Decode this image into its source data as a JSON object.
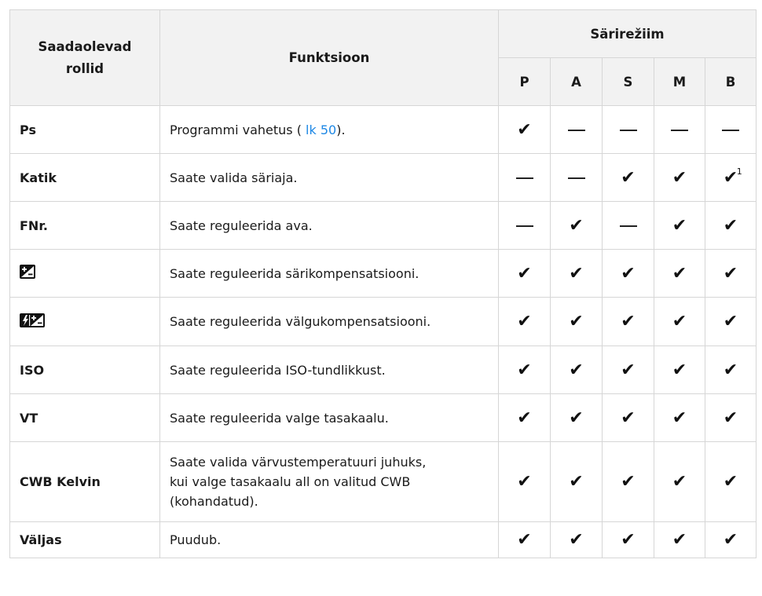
{
  "header": {
    "roles": "Saadaolevad rollid",
    "function": "Funktsioon",
    "mode_group": "Särirežiim",
    "modes": [
      "P",
      "A",
      "S",
      "M",
      "B"
    ]
  },
  "rows": [
    {
      "role": "Ps",
      "func_pre": "Programmi vahetus ( ",
      "func_link": "lk 50",
      "func_post": ").",
      "marks": [
        "check",
        "dash",
        "dash",
        "dash",
        "dash"
      ]
    },
    {
      "role": "Katik",
      "func": "Saate valida säriaja.",
      "marks": [
        "dash",
        "dash",
        "check",
        "check",
        "check"
      ],
      "note": "1"
    },
    {
      "role": "FNr.",
      "func": "Saate reguleerida ava.",
      "marks": [
        "dash",
        "check",
        "dash",
        "check",
        "check"
      ]
    },
    {
      "role_icon": "exposure-compensation-icon",
      "func": "Saate reguleerida särikompensatsiooni.",
      "marks": [
        "check",
        "check",
        "check",
        "check",
        "check"
      ]
    },
    {
      "role_icon": "flash-compensation-icon",
      "func": "Saate reguleerida välgukompensatsiooni.",
      "marks": [
        "check",
        "check",
        "check",
        "check",
        "check"
      ]
    },
    {
      "role": "ISO",
      "func": "Saate reguleerida ISO-tundlikkust.",
      "marks": [
        "check",
        "check",
        "check",
        "check",
        "check"
      ]
    },
    {
      "role": "VT",
      "func": "Saate reguleerida valge tasakaalu.",
      "marks": [
        "check",
        "check",
        "check",
        "check",
        "check"
      ]
    },
    {
      "role": "CWB Kelvin",
      "func_lines": [
        "Saate valida värvustemperatuuri juhuks,",
        "kui valge tasakaalu all on valitud CWB",
        "(kohandatud)."
      ],
      "marks": [
        "check",
        "check",
        "check",
        "check",
        "check"
      ]
    },
    {
      "role": "Väljas",
      "func": "Puudub.",
      "marks": [
        "check",
        "check",
        "check",
        "check",
        "check"
      ]
    }
  ]
}
